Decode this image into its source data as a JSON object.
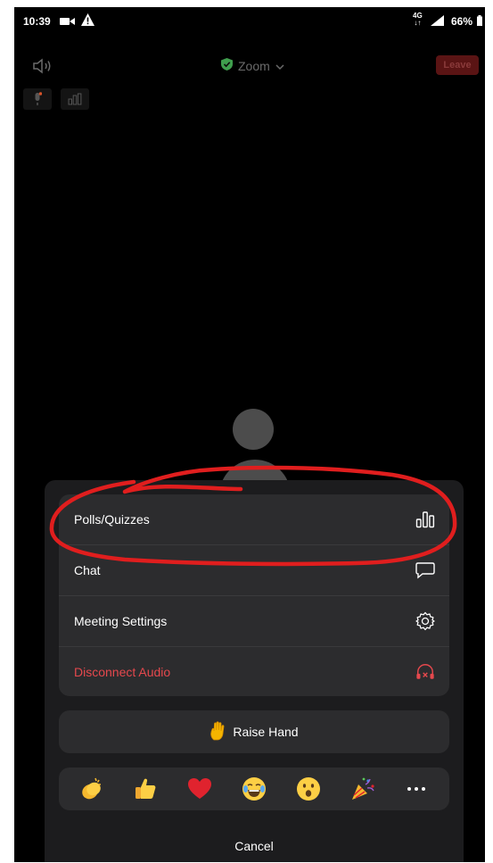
{
  "status_bar": {
    "time": "10:39",
    "network": "4G",
    "battery": "66%"
  },
  "meeting": {
    "title": "Zoom",
    "leave_label": "Leave"
  },
  "menu": {
    "items": [
      {
        "label": "Polls/Quizzes",
        "icon": "poll-icon"
      },
      {
        "label": "Chat",
        "icon": "chat-icon"
      },
      {
        "label": "Meeting Settings",
        "icon": "gear-icon"
      },
      {
        "label": "Disconnect Audio",
        "icon": "headphones-off-icon",
        "color": "#e5484d"
      }
    ]
  },
  "raise_hand": {
    "label": "Raise Hand"
  },
  "reactions": [
    "clap",
    "thumbs-up",
    "heart",
    "joy",
    "open-mouth",
    "tada",
    "more"
  ],
  "cancel_label": "Cancel",
  "colors": {
    "sheet_bg": "#1c1c1e",
    "item_bg": "#2c2c2e",
    "danger": "#e5484d",
    "leave_bg": "#5a1414",
    "annotation": "#e01e1e"
  }
}
